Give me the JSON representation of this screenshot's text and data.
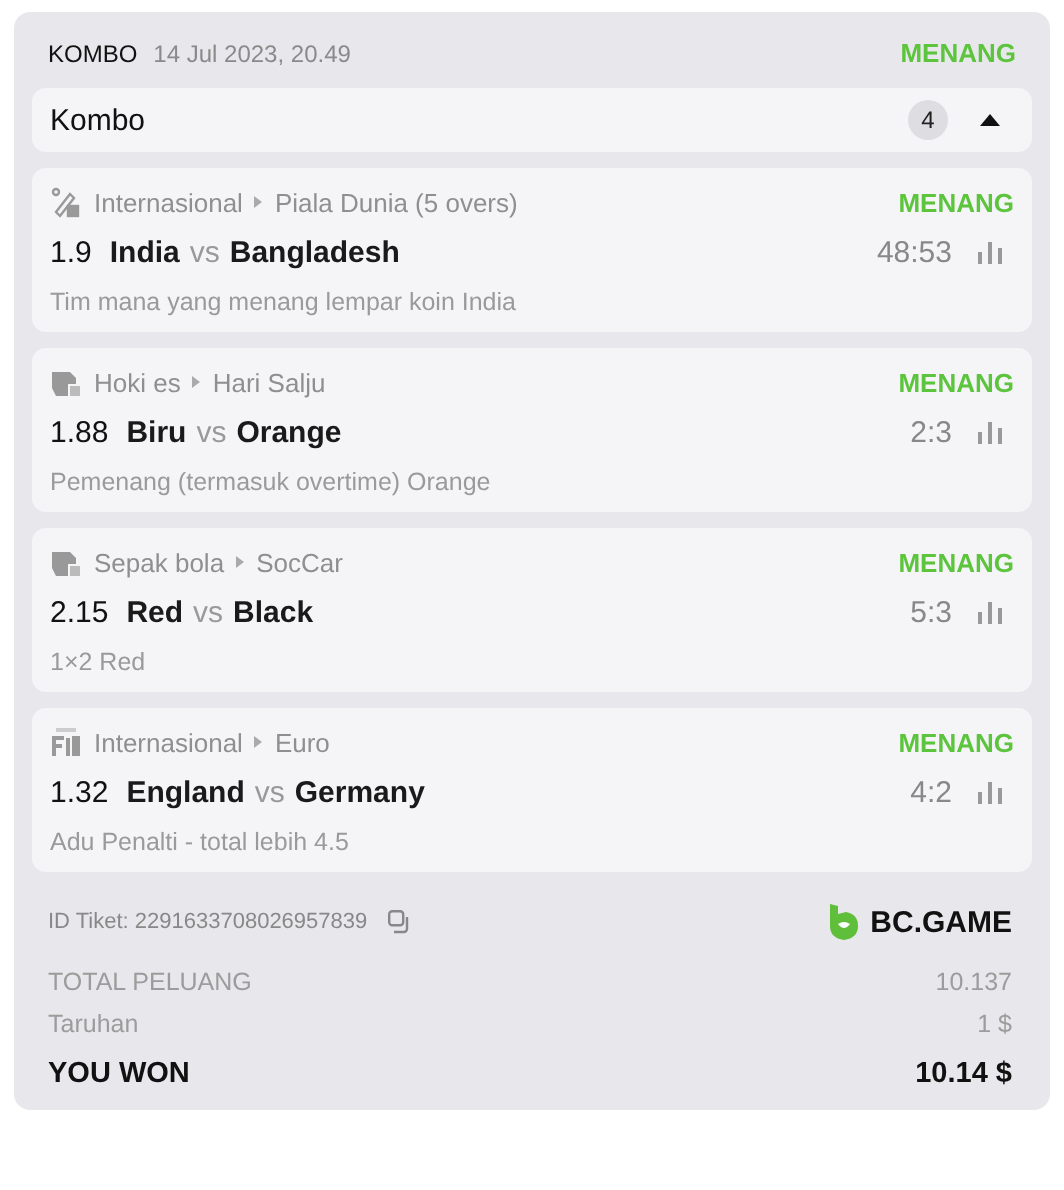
{
  "header": {
    "type": "KOMBO",
    "date": "14 Jul 2023, 20.49",
    "status": "MENANG"
  },
  "combo_bar": {
    "title": "Kombo",
    "count": "4",
    "expanded": true
  },
  "bets": [
    {
      "kind": "cricket",
      "category": "Internasional",
      "league": "Piala Dunia (5 overs)",
      "status": "MENANG",
      "odds": "1.9",
      "home": "India",
      "vs": "vs",
      "away": "Bangladesh",
      "score": "48:53",
      "market": "Tim mana yang menang lempar koin India"
    },
    {
      "kind": "esport",
      "category": "Hoki es",
      "league": "Hari Salju",
      "status": "MENANG",
      "odds": "1.88",
      "home": "Biru",
      "vs": "vs",
      "away": "Orange",
      "score": "2:3",
      "market": "Pemenang (termasuk overtime) Orange"
    },
    {
      "kind": "esport",
      "category": "Sepak bola",
      "league": "SocCar",
      "status": "MENANG",
      "odds": "2.15",
      "home": "Red",
      "vs": "vs",
      "away": "Black",
      "score": "5:3",
      "market": "1×2 Red"
    },
    {
      "kind": "fifa",
      "category": "Internasional",
      "league": "Euro",
      "status": "MENANG",
      "odds": "1.32",
      "home": "England",
      "vs": "vs",
      "away": "Germany",
      "score": "4:2",
      "market": "Adu Penalti - total lebih 4.5"
    }
  ],
  "ticket": {
    "id": "ID Tiket: 2291633708026957839",
    "logo": "BC.GAME"
  },
  "summary": [
    {
      "kind": "muted",
      "label": "TOTAL PELUANG",
      "value": "10.137"
    },
    {
      "kind": "muted",
      "label": "Taruhan",
      "value": "1 $"
    },
    {
      "kind": "total",
      "label": "YOU WON",
      "value": "10.14 $"
    }
  ]
}
